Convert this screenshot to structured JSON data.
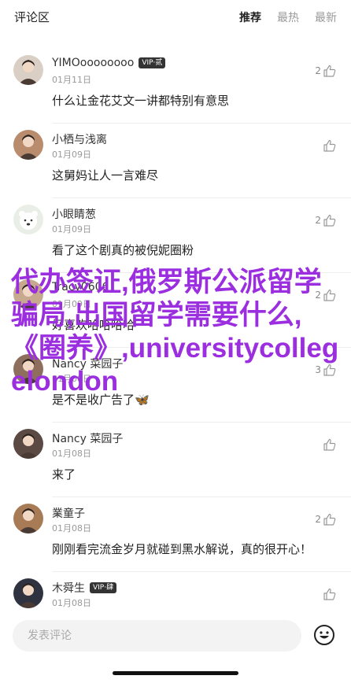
{
  "header": {
    "title": "评论区",
    "tabs": [
      {
        "label": "推荐",
        "active": true
      },
      {
        "label": "最热",
        "active": false
      },
      {
        "label": "最新",
        "active": false
      }
    ]
  },
  "comments": [
    {
      "name": "YIMOoooooooo",
      "vip": "VIP·贰",
      "date": "01月11日",
      "text": "什么让金花艾文一讲都特别有意思",
      "likes": "2",
      "avatar": "avatar-photo"
    },
    {
      "name": "小栖与浅离",
      "vip": "",
      "date": "01月09日",
      "text": "这舅妈让人一言难尽",
      "likes": "",
      "avatar": "avatar-photo"
    },
    {
      "name": "小眼睛葱",
      "vip": "",
      "date": "01月09日",
      "text": "看了这个剧真的被倪妮圈粉",
      "likes": "2",
      "avatar": "avatar-bear"
    },
    {
      "name": "Tracy0606",
      "vip": "",
      "date": "01月09日",
      "text": "好喜欢哈哈哈哈",
      "likes": "2",
      "avatar": "avatar-photo"
    },
    {
      "name": "Nancy 菜园子",
      "vip": "",
      "date": "01月08日",
      "text": "是不是收广告了🦋",
      "likes": "3",
      "avatar": "avatar-photo"
    },
    {
      "name": "Nancy 菜园子",
      "vip": "",
      "date": "01月08日",
      "text": "来了",
      "likes": "",
      "avatar": "avatar-photo"
    },
    {
      "name": "業童子",
      "vip": "",
      "date": "01月08日",
      "text": "刚刚看完流金岁月就碰到黑水解说，真的很开心！",
      "likes": "2",
      "avatar": "avatar-photo"
    },
    {
      "name": "木舜生",
      "vip": "VIP·肆",
      "date": "01月08日",
      "text": "",
      "likes": "",
      "avatar": "avatar-photo"
    }
  ],
  "input": {
    "placeholder": "发表评论"
  },
  "overlay_text": "代办签证,俄罗斯公派留学骗局,出国留学需要什么,《圈养》,universitycollegelondon",
  "colors": {
    "overlay": "#9b2fe0",
    "vip_bg": "#333333"
  }
}
